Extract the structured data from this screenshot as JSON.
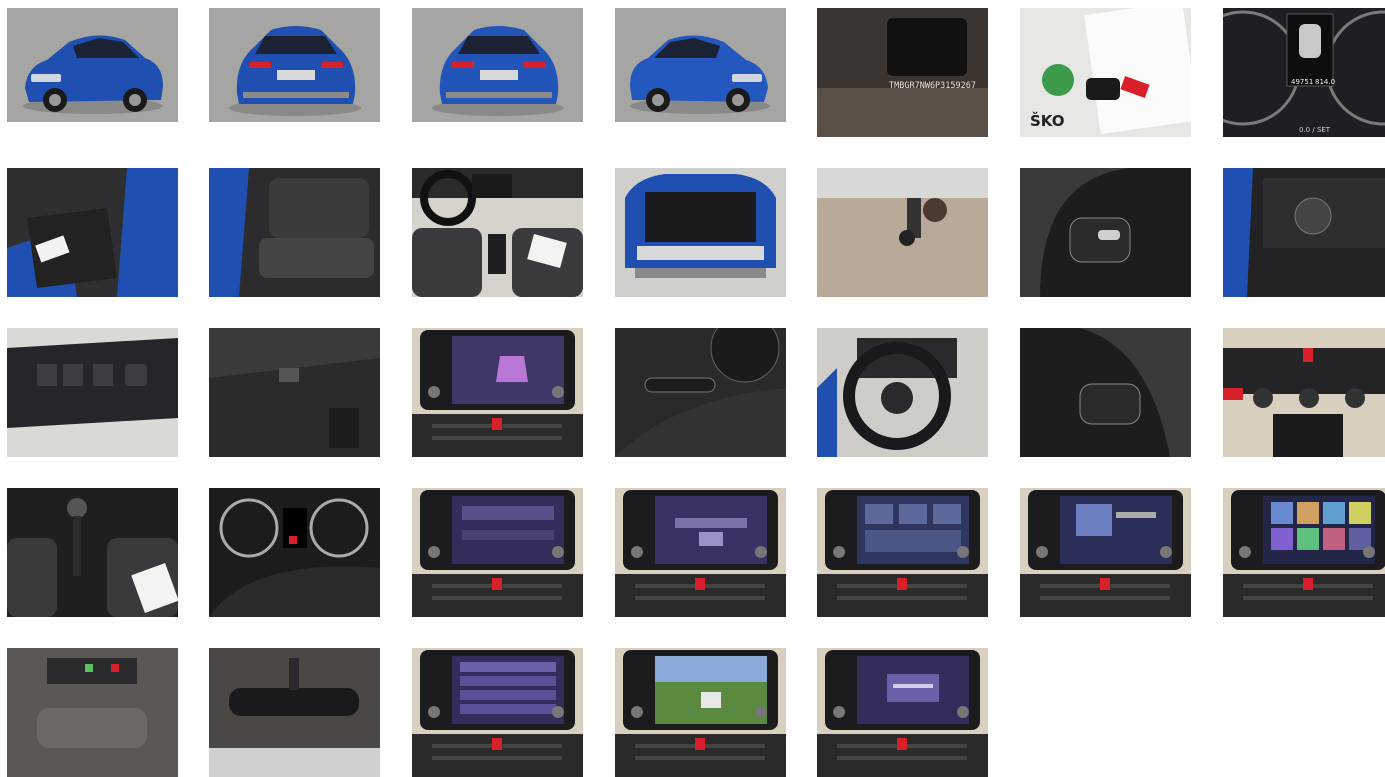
{
  "gallery": {
    "photos": [
      {
        "kind": "exterior-front",
        "icon": "car-front-icon"
      },
      {
        "kind": "exterior-rear",
        "icon": "car-rear-icon"
      },
      {
        "kind": "exterior-rear-2",
        "icon": "car-rear-icon"
      },
      {
        "kind": "exterior-front-2",
        "icon": "car-front-icon"
      },
      {
        "kind": "vin-plate",
        "icon": "vin-icon",
        "text": "TMBGR7NW6P3159267"
      },
      {
        "kind": "key-and-papers",
        "icon": "key-icon",
        "text": "ŠKO"
      },
      {
        "kind": "odometer",
        "icon": "gauge-icon",
        "text": "49751",
        "text2": "814.0",
        "text3": "0.0 / SET"
      },
      {
        "kind": "front-door-open",
        "icon": "door-icon"
      },
      {
        "kind": "rear-seats",
        "icon": "seat-icon"
      },
      {
        "kind": "dashboard",
        "icon": "dashboard-icon"
      },
      {
        "kind": "trunk",
        "icon": "trunk-icon"
      },
      {
        "kind": "tow-hitch",
        "icon": "hitch-icon"
      },
      {
        "kind": "steering-controls-right",
        "icon": "steering-icon"
      },
      {
        "kind": "light-switch",
        "icon": "switch-icon"
      },
      {
        "kind": "window-controls",
        "icon": "window-switch-icon"
      },
      {
        "kind": "trunk-side",
        "icon": "trunk-icon"
      },
      {
        "kind": "infotainment-car",
        "icon": "screen-icon"
      },
      {
        "kind": "stalk-controls",
        "icon": "stalk-icon"
      },
      {
        "kind": "steering-wheel",
        "icon": "steering-icon"
      },
      {
        "kind": "steering-controls-left",
        "icon": "steering-icon"
      },
      {
        "kind": "climate-controls",
        "icon": "climate-icon"
      },
      {
        "kind": "gear-shift",
        "icon": "gear-icon"
      },
      {
        "kind": "instrument-cluster",
        "icon": "gauge-icon"
      },
      {
        "kind": "infotainment-phone",
        "icon": "screen-icon"
      },
      {
        "kind": "infotainment-message",
        "icon": "screen-icon"
      },
      {
        "kind": "infotainment-menu",
        "icon": "screen-icon"
      },
      {
        "kind": "infotainment-media",
        "icon": "screen-icon"
      },
      {
        "kind": "infotainment-apps",
        "icon": "screen-icon"
      },
      {
        "kind": "overhead-console",
        "icon": "light-icon"
      },
      {
        "kind": "rear-mirror",
        "icon": "mirror-icon"
      },
      {
        "kind": "infotainment-settings",
        "icon": "screen-icon"
      },
      {
        "kind": "infotainment-camera",
        "icon": "camera-icon"
      },
      {
        "kind": "infotainment-bluetooth",
        "icon": "screen-icon"
      }
    ]
  },
  "colors": {
    "car_blue": "#1f4fb0",
    "studio_gray": "#a5a5a3",
    "interior_dark": "#2a2a2c",
    "garage_white": "#dcdcd8",
    "screen_purple": "#5a4a8c",
    "panel_beige": "#d8cfbf",
    "accent_red": "#d8202a"
  }
}
